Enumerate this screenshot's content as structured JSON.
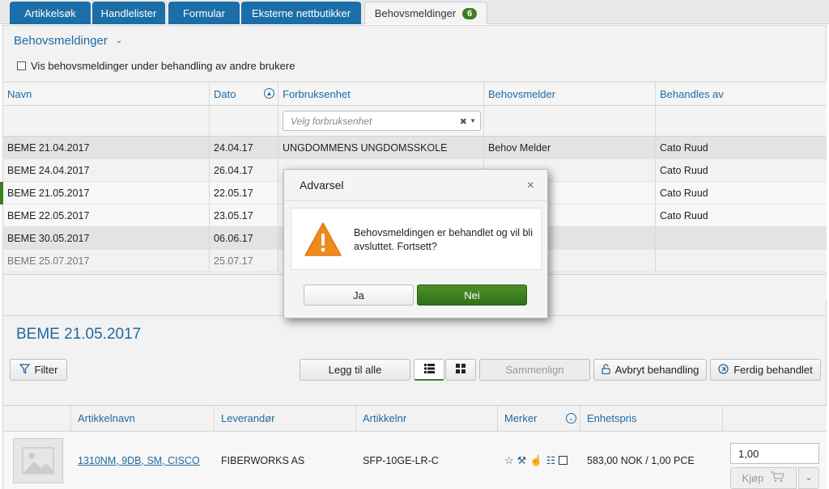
{
  "tabs": [
    {
      "label": "Artikkelsøk"
    },
    {
      "label": "Handlelister"
    },
    {
      "label": "Formular"
    },
    {
      "label": "Eksterne nettbutikker"
    },
    {
      "label": "Behovsmeldinger",
      "badge": "6"
    }
  ],
  "section": {
    "title": "Behovsmeldinger",
    "checkbox_label": "Vis behovsmeldinger under behandling av andre brukere"
  },
  "grid": {
    "columns": [
      "Navn",
      "Dato",
      "Forbruksenhet",
      "Behovsmelder",
      "Behandles av"
    ],
    "filter_placeholder": "Velg forbruksenhet",
    "rows": [
      {
        "navn": "BEME 21.04.2017",
        "dato": "24.04.17",
        "enhet": "UNGDOMMENS UNGDOMSSKOLE",
        "melder": "Behov Melder",
        "behandles": "Cato Ruud"
      },
      {
        "navn": "BEME 24.04.2017",
        "dato": "26.04.17",
        "enhet": "",
        "melder": "",
        "behandles": "Cato Ruud"
      },
      {
        "navn": "BEME 21.05.2017",
        "dato": "22.05.17",
        "enhet": "U",
        "melder": "",
        "behandles": "Cato Ruud"
      },
      {
        "navn": "BEME 22.05.2017",
        "dato": "23.05.17",
        "enhet": "U",
        "melder": "",
        "behandles": "Cato Ruud"
      },
      {
        "navn": "BEME 30.05.2017",
        "dato": "06.06.17",
        "enhet": "U",
        "melder": "",
        "behandles": ""
      },
      {
        "navn": "BEME 25.07.2017",
        "dato": "25.07.17",
        "enhet": "U",
        "melder": "",
        "behandles": ""
      }
    ]
  },
  "detail": {
    "title": "BEME 21.05.2017",
    "filter_label": "Filter",
    "add_all_label": "Legg til alle",
    "compare_label": "Sammenlign",
    "cancel_label": "Avbryt behandling",
    "done_label": "Ferdig behandlet"
  },
  "products": {
    "columns": [
      "Artikkelnavn",
      "Leverandør",
      "Artikkelnr",
      "Merker",
      "Enhetspris"
    ],
    "row": {
      "name": "1310NM, 9DB, SM, CISCO",
      "supplier": "FIBERWORKS AS",
      "number": "SFP-10GE-LR-C",
      "price": "583,00 NOK / 1,00 PCE",
      "qty": "1,00",
      "buy_label": "Kjøp"
    }
  },
  "dialog": {
    "title": "Advarsel",
    "message": "Behovsmeldingen er behandlet og vil bli avsluttet. Fortsett?",
    "yes_label": "Ja",
    "no_label": "Nei"
  }
}
